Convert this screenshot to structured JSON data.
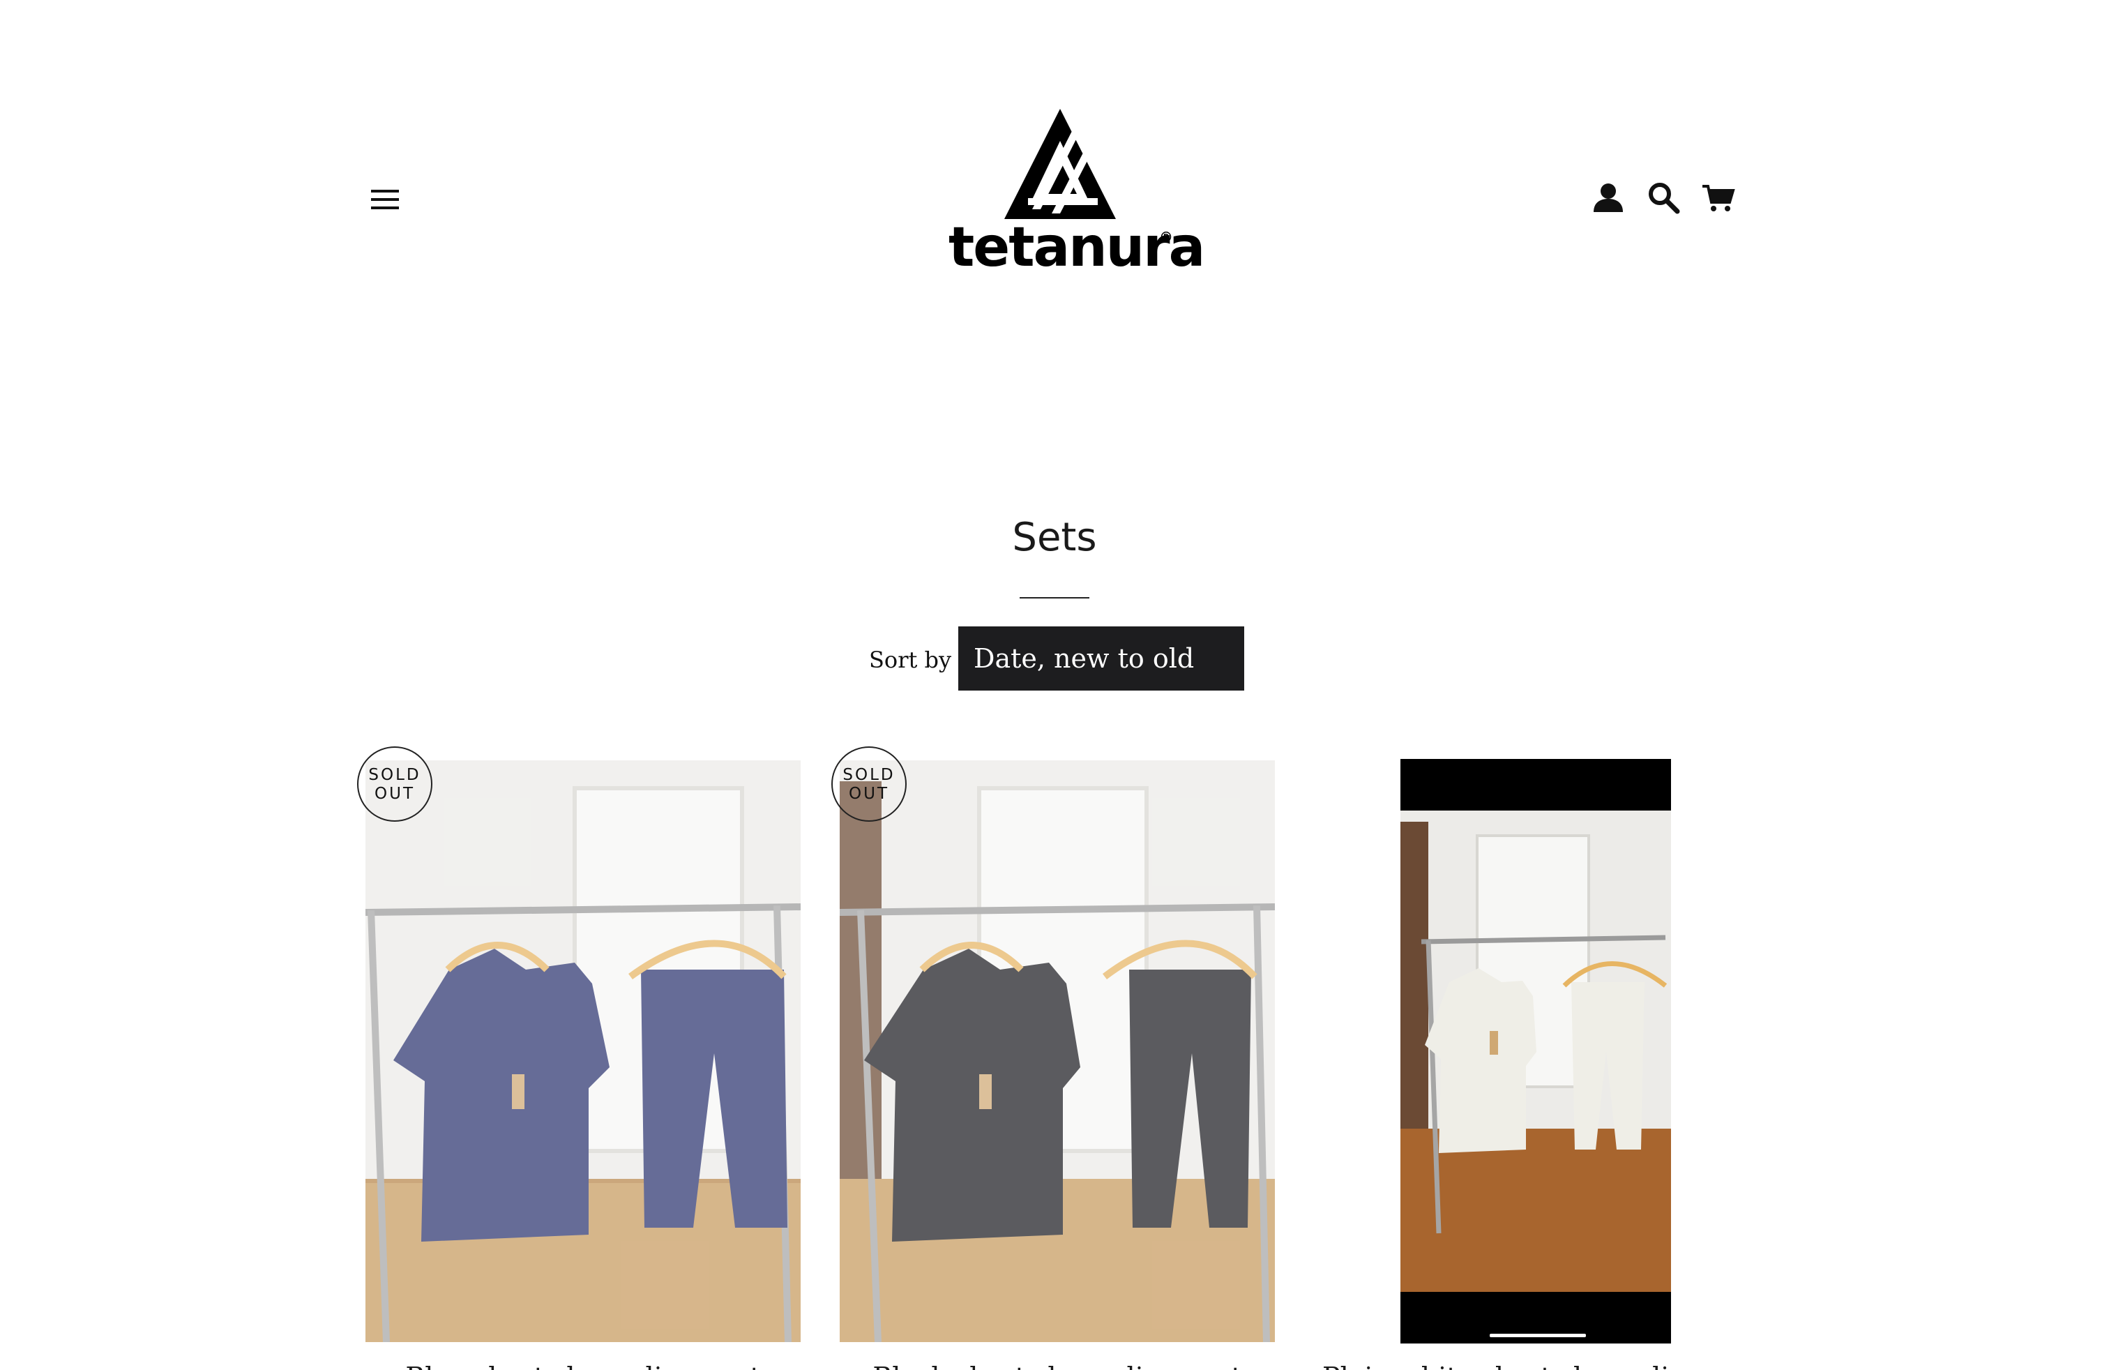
{
  "header": {
    "brand_name": "tetanura",
    "brand_mark": "®",
    "menu_icon": "hamburger-menu-icon",
    "account_icon": "user-icon",
    "search_icon": "search-icon",
    "cart_icon": "cart-icon"
  },
  "collection": {
    "title": "Sets",
    "sort_label": "Sort by",
    "sort_selected": "Date, new to old"
  },
  "products": [
    {
      "name": "Blue short sleeve linen set",
      "badge_line1": "SOLD",
      "badge_line2": "OUT",
      "color": "#2b3470"
    },
    {
      "name": "Black short sleeve linen set",
      "badge_line1": "SOLD",
      "badge_line2": "OUT",
      "color": "#1c1d22"
    },
    {
      "name": "Plain white short sleeve linen set",
      "color": "#efeee7"
    }
  ]
}
